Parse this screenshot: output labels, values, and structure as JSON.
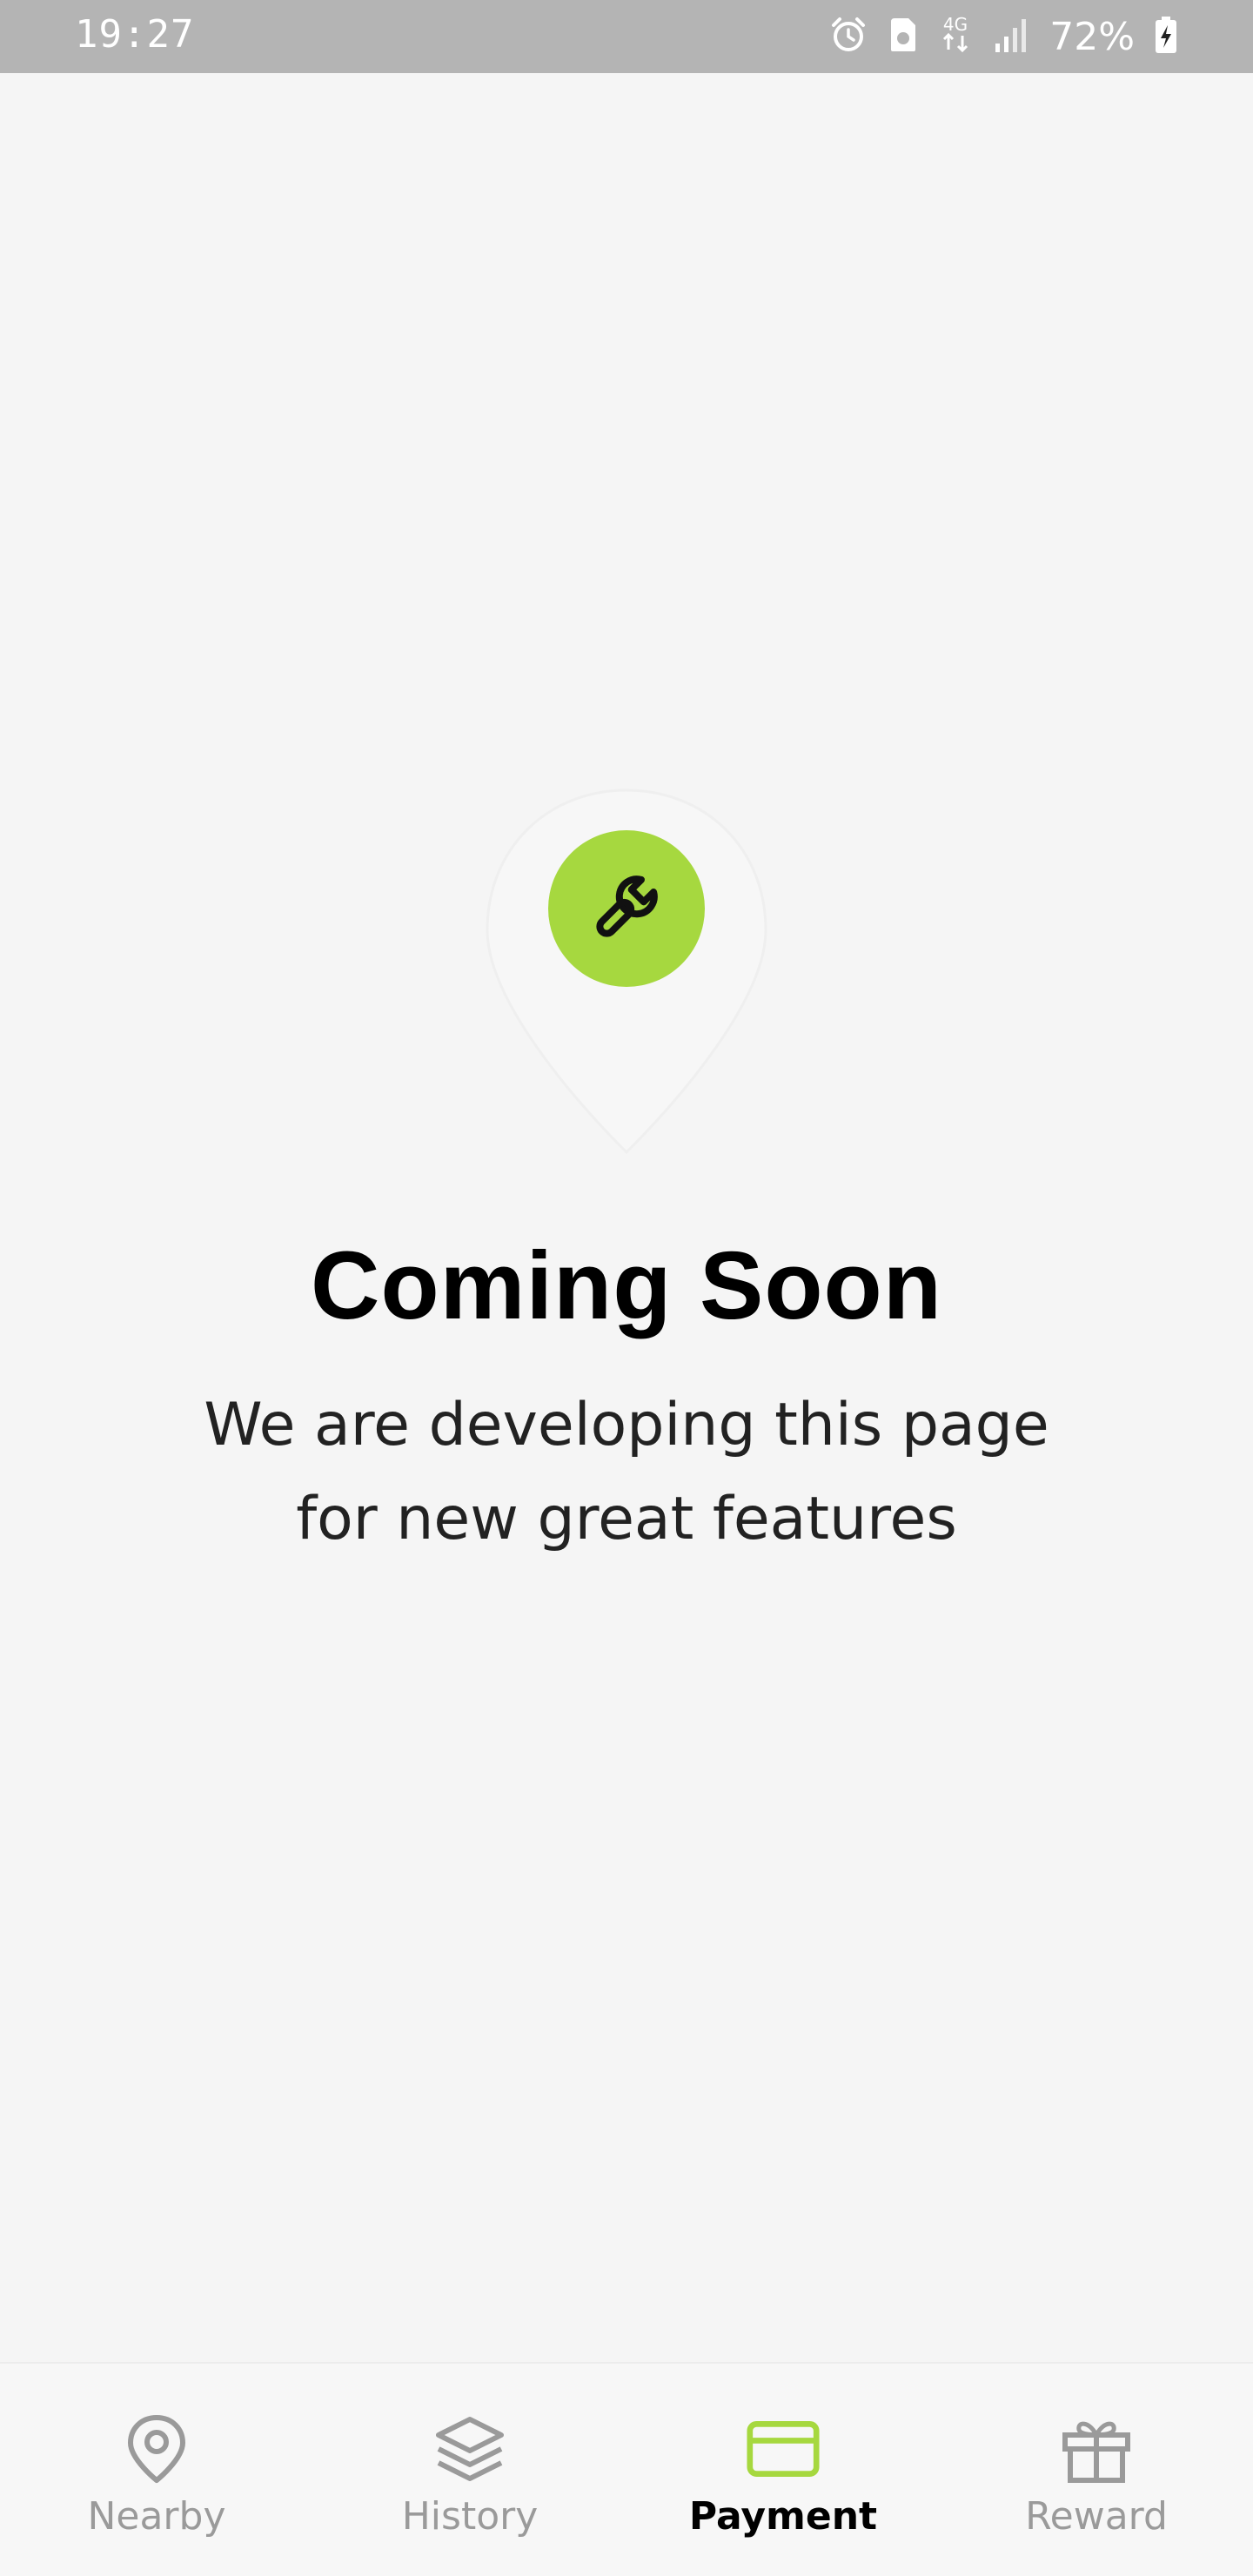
{
  "status_bar": {
    "time": "19:27",
    "network": "4G",
    "battery": "72%",
    "icons": [
      "alarm-icon",
      "storage-icon",
      "network-4g-icon",
      "signal-icon",
      "battery-charging-icon"
    ]
  },
  "main": {
    "illustration_icon": "wrench-icon",
    "accent_color": "#a6d83f",
    "title": "Coming Soon",
    "subtitle_line1": "We are developing this page",
    "subtitle_line2": "for new great features"
  },
  "bottom_nav": {
    "items": [
      {
        "label": "Nearby",
        "icon": "location-pin-icon",
        "active": false
      },
      {
        "label": "History",
        "icon": "layers-icon",
        "active": false
      },
      {
        "label": "Payment",
        "icon": "card-icon",
        "active": true
      },
      {
        "label": "Reward",
        "icon": "gift-icon",
        "active": false
      }
    ]
  }
}
